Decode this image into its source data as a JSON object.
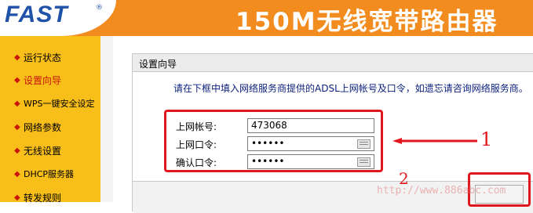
{
  "header": {
    "logo": "FAST",
    "logo_mark": "®",
    "title": "150M无线宽带路由器"
  },
  "sidebar": {
    "items": [
      {
        "label": "运行状态"
      },
      {
        "label": "设置向导",
        "active": true
      },
      {
        "label": "WPS一键安全设定"
      },
      {
        "label": "网络参数"
      },
      {
        "label": "无线设置"
      },
      {
        "label": "DHCP服务器"
      },
      {
        "label": "转发规则"
      }
    ]
  },
  "panel": {
    "title": "设置向导",
    "description": "请在下框中填入网络服务商提供的ADSL上网帐号及口令，如遗忘请咨询网络服务商。"
  },
  "form": {
    "account_label": "上网帐号:",
    "account_value": "473068",
    "password_label": "上网口令:",
    "password_value": "••••••",
    "confirm_label": "确认口令:",
    "confirm_value": "••••••"
  },
  "annotations": {
    "step1": "1",
    "step2": "2",
    "watermark": "http://www.886abc.com"
  },
  "colors": {
    "header_orange": "#f28c1e",
    "sidebar_yellow": "#f8be1a",
    "annotation_red": "#e0181e",
    "logo_blue": "#1f52a8"
  }
}
